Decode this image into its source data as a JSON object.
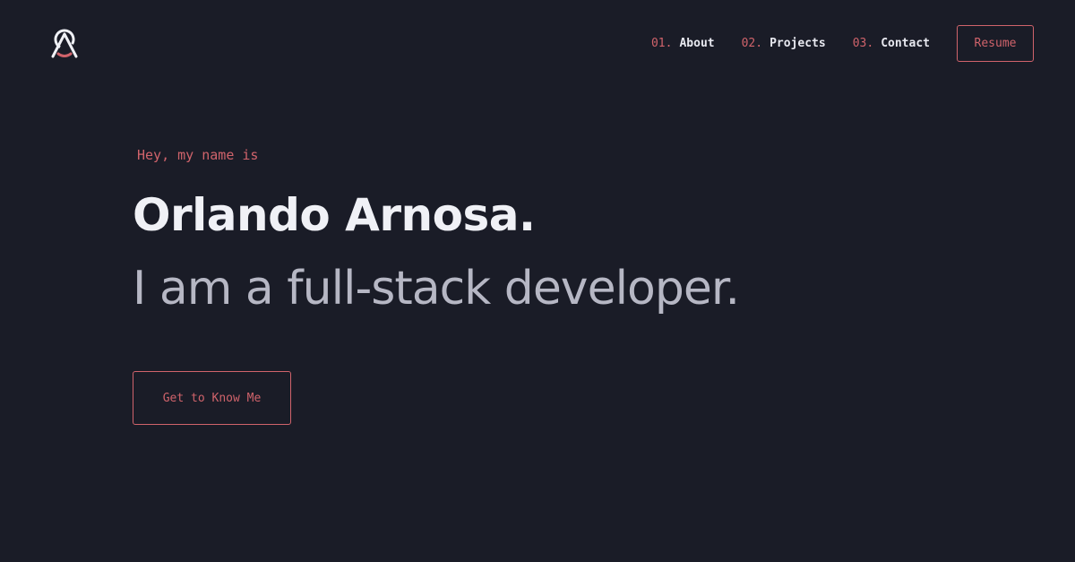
{
  "header": {
    "logo_icon": "logo-mark-icon",
    "nav": [
      {
        "number": "01.",
        "label": "About"
      },
      {
        "number": "02.",
        "label": "Projects"
      },
      {
        "number": "03.",
        "label": "Contact"
      }
    ],
    "resume_label": "Resume"
  },
  "hero": {
    "greeting": "Hey, my name is",
    "name": "Orlando Arnosa.",
    "tagline": "I am a full-stack developer.",
    "cta_label": "Get to Know Me"
  },
  "colors": {
    "background": "#1a1c27",
    "accent": "#d0636b",
    "text_primary": "#f0f1f6",
    "text_secondary": "#b6b7c4"
  }
}
